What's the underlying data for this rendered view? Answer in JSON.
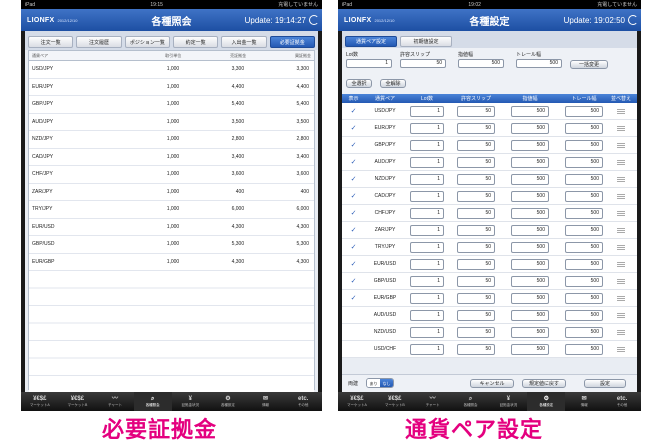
{
  "left": {
    "status_left": "iPad",
    "status_time": "19:15",
    "status_right": "充電していません",
    "logo": "LIONFX",
    "logo_date": "2012/12/10",
    "title": "各種照会",
    "update": "Update: 19:14:27",
    "tabs": [
      "注文一覧",
      "注文履歴",
      "ポジション一覧",
      "約定一覧",
      "入出金一覧",
      "必要証拠金"
    ],
    "table": {
      "headers": [
        "通貨ペア",
        "取引単位",
        "売証拠金",
        "買証拠金"
      ],
      "rows": [
        [
          "USD/JPY",
          "1,000",
          "3,300",
          "3,300"
        ],
        [
          "EUR/JPY",
          "1,000",
          "4,400",
          "4,400"
        ],
        [
          "GBP/JPY",
          "1,000",
          "5,400",
          "5,400"
        ],
        [
          "AUD/JPY",
          "1,000",
          "3,500",
          "3,500"
        ],
        [
          "NZD/JPY",
          "1,000",
          "2,800",
          "2,800"
        ],
        [
          "CAD/JPY",
          "1,000",
          "3,400",
          "3,400"
        ],
        [
          "CHF/JPY",
          "1,000",
          "3,600",
          "3,600"
        ],
        [
          "ZAR/JPY",
          "1,000",
          "400",
          "400"
        ],
        [
          "TRY/JPY",
          "1,000",
          "6,000",
          "6,000"
        ],
        [
          "EUR/USD",
          "1,000",
          "4,300",
          "4,300"
        ],
        [
          "GBP/USD",
          "1,000",
          "5,300",
          "5,300"
        ],
        [
          "EUR/GBP",
          "1,000",
          "4,300",
          "4,300"
        ]
      ]
    },
    "caption": "必要証拠金"
  },
  "right": {
    "status_left": "iPad",
    "status_time": "19:02",
    "status_right": "充電していません",
    "logo": "LIONFX",
    "logo_date": "2012/12/10",
    "title": "各種設定",
    "update": "Update: 19:02:50",
    "tabs": [
      "通貨ペア設定",
      "初期値設定"
    ],
    "bulk": {
      "lot_label": "Lot数",
      "lot_value": "1",
      "slip_label": "許容スリップ",
      "slip_value": "50",
      "limit_label": "指値幅",
      "limit_value": "500",
      "trail_label": "トレール幅",
      "trail_value": "500",
      "apply_all": "一括変更",
      "select_all": "全選択",
      "deselect_all": "全解除"
    },
    "columns": [
      "表示",
      "通貨ペア",
      "Lot数",
      "許容スリップ",
      "指値幅",
      "トレール幅",
      "並べ替え"
    ],
    "rows": [
      {
        "check": "✓",
        "pair": "USD/JPY",
        "lot": "1",
        "slip": "50",
        "limit": "500",
        "trail": "500"
      },
      {
        "check": "✓",
        "pair": "EUR/JPY",
        "lot": "1",
        "slip": "50",
        "limit": "500",
        "trail": "500"
      },
      {
        "check": "✓",
        "pair": "GBP/JPY",
        "lot": "1",
        "slip": "50",
        "limit": "500",
        "trail": "500"
      },
      {
        "check": "✓",
        "pair": "AUD/JPY",
        "lot": "1",
        "slip": "50",
        "limit": "500",
        "trail": "500"
      },
      {
        "check": "✓",
        "pair": "NZD/JPY",
        "lot": "1",
        "slip": "50",
        "limit": "500",
        "trail": "500"
      },
      {
        "check": "✓",
        "pair": "CAD/JPY",
        "lot": "1",
        "slip": "50",
        "limit": "500",
        "trail": "500"
      },
      {
        "check": "✓",
        "pair": "CHF/JPY",
        "lot": "1",
        "slip": "50",
        "limit": "500",
        "trail": "500"
      },
      {
        "check": "✓",
        "pair": "ZAR/JPY",
        "lot": "1",
        "slip": "50",
        "limit": "500",
        "trail": "500"
      },
      {
        "check": "✓",
        "pair": "TRY/JPY",
        "lot": "1",
        "slip": "50",
        "limit": "500",
        "trail": "500"
      },
      {
        "check": "✓",
        "pair": "EUR/USD",
        "lot": "1",
        "slip": "50",
        "limit": "500",
        "trail": "500"
      },
      {
        "check": "✓",
        "pair": "GBP/USD",
        "lot": "1",
        "slip": "50",
        "limit": "500",
        "trail": "500"
      },
      {
        "check": "✓",
        "pair": "EUR/GBP",
        "lot": "1",
        "slip": "50",
        "limit": "500",
        "trail": "500"
      },
      {
        "check": "",
        "pair": "AUD/USD",
        "lot": "1",
        "slip": "50",
        "limit": "500",
        "trail": "500"
      },
      {
        "check": "",
        "pair": "NZD/USD",
        "lot": "1",
        "slip": "50",
        "limit": "500",
        "trail": "500"
      },
      {
        "check": "",
        "pair": "USD/CHF",
        "lot": "1",
        "slip": "50",
        "limit": "500",
        "trail": "500"
      }
    ],
    "footer": {
      "two_way_label": "両建",
      "seg_on": "あり",
      "seg_off": "なし",
      "cancel": "キャンセル",
      "reset": "規定値に戻す",
      "save": "設定"
    },
    "caption": "通貨ペア設定"
  },
  "tabbar_left": [
    {
      "icon": "¥€$£",
      "label": "マーケットA",
      "active": false
    },
    {
      "icon": "¥€$£",
      "label": "マーケットB",
      "active": false
    },
    {
      "icon": "〰",
      "label": "チャート",
      "active": false
    },
    {
      "icon": "⌕",
      "label": "各種照会",
      "active": true
    },
    {
      "icon": "¥",
      "label": "証拠金状況",
      "active": false
    },
    {
      "icon": "⚙",
      "label": "各種設定",
      "active": false
    },
    {
      "icon": "✉",
      "label": "情報",
      "active": false
    },
    {
      "icon": "etc.",
      "label": "その他",
      "active": false
    }
  ],
  "tabbar_right": [
    {
      "icon": "¥€$£",
      "label": "マーケットA",
      "active": false
    },
    {
      "icon": "¥€$£",
      "label": "マーケットB",
      "active": false
    },
    {
      "icon": "〰",
      "label": "チャート",
      "active": false
    },
    {
      "icon": "⌕",
      "label": "各種照会",
      "active": false
    },
    {
      "icon": "¥",
      "label": "証拠金状況",
      "active": false
    },
    {
      "icon": "⚙",
      "label": "各種設定",
      "active": true
    },
    {
      "icon": "✉",
      "label": "情報",
      "active": false
    },
    {
      "icon": "etc.",
      "label": "その他",
      "active": false
    }
  ],
  "colors": {
    "navbar": "#2a5db3",
    "accent": "#e4007f",
    "tab_active": "#2459b3"
  }
}
